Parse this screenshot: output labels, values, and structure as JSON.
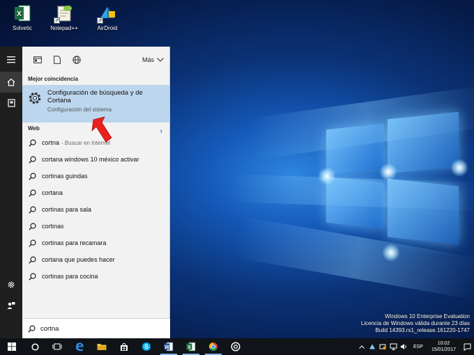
{
  "desktop": {
    "icons": [
      {
        "label": "Solvetic",
        "icon": "excel-icon"
      },
      {
        "label": "Notepad++",
        "icon": "notepad-plus-plus-icon"
      },
      {
        "label": "AirDroid",
        "icon": "airdroid-icon"
      }
    ],
    "watermark": {
      "line1": "Windows 10 Enterprise Evaluation",
      "line2": "Licencia de Windows válida durante 23 días",
      "line3": "Build 14393.rs1_release.161220-1747"
    }
  },
  "search_panel": {
    "more_label": "Más",
    "best_match_label": "Mejor coincidencia",
    "best_match": {
      "title": "Configuración de búsqueda y de Cortana",
      "subtitle": "Configuración del sistema"
    },
    "web_label": "Web",
    "suggestions": [
      {
        "text": "cortna",
        "hint": "- Buscar en Internet"
      },
      {
        "text": "cortana windows 10 méxico activar",
        "hint": ""
      },
      {
        "text": "cortinas guindas",
        "hint": ""
      },
      {
        "text": "cortana",
        "hint": ""
      },
      {
        "text": "cortinas para sala",
        "hint": ""
      },
      {
        "text": "cortinas",
        "hint": ""
      },
      {
        "text": "cortinas para recamara",
        "hint": ""
      },
      {
        "text": "cortana que puedes hacer",
        "hint": ""
      },
      {
        "text": "cortinas para cocina",
        "hint": ""
      }
    ],
    "search_value": "cortna"
  },
  "taskbar": {
    "language": "ESP",
    "time": "10:02",
    "date": "15/01/2017"
  },
  "colors": {
    "accent": "#1a73d9",
    "selection": "#bcd6ee",
    "arrow": "#e8201e"
  }
}
